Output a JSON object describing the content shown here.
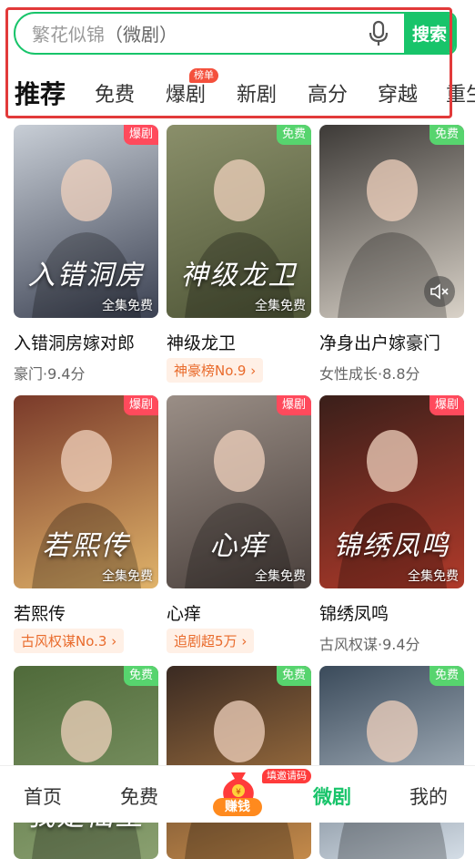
{
  "search": {
    "placeholder_main": "繁花似锦",
    "placeholder_tag": "（微剧）",
    "button": "搜索"
  },
  "tabs": [
    {
      "label": "推荐",
      "active": true
    },
    {
      "label": "免费"
    },
    {
      "label": "爆剧",
      "badge": "榜单"
    },
    {
      "label": "新剧"
    },
    {
      "label": "高分"
    },
    {
      "label": "穿越"
    },
    {
      "label": "重生"
    }
  ],
  "cards": [
    {
      "title": "入错洞房嫁对郎",
      "corner": "爆剧",
      "full": "全集免费",
      "overlay": "入错洞房",
      "sub": "豪门·9.4分",
      "colors": [
        "#c8ced6",
        "#3b4152"
      ]
    },
    {
      "title": "神级龙卫",
      "corner": "免费",
      "full": "全集免费",
      "overlay": "神级龙卫",
      "rank": "神豪榜No.9",
      "colors": [
        "#8a8f6a",
        "#4e5536"
      ]
    },
    {
      "title": "净身出户嫁豪门",
      "corner": "免费",
      "full": "",
      "overlay": "",
      "sub": "女性成长·8.8分",
      "colors": [
        "#3d3a37",
        "#d9d2c8"
      ]
    },
    {
      "title": "若熙传",
      "corner": "爆剧",
      "full": "全集免费",
      "overlay": "若熙传",
      "rank": "古风权谋No.3",
      "colors": [
        "#7a3a2a",
        "#e0b36a"
      ]
    },
    {
      "title": "心痒",
      "corner": "爆剧",
      "full": "全集免费",
      "overlay": "心痒",
      "rank": "追剧超5万",
      "colors": [
        "#9a8e86",
        "#4a403c"
      ]
    },
    {
      "title": "锦绣凤鸣",
      "corner": "爆剧",
      "full": "全集免费",
      "overlay": "锦绣凤鸣",
      "sub": "古风权谋·9.4分",
      "colors": [
        "#3a1f1a",
        "#b03a2a"
      ]
    },
    {
      "title": "",
      "corner": "免费",
      "full": "",
      "overlay": "我是仙王",
      "sub": "",
      "colors": [
        "#4f6a3a",
        "#8aa070"
      ]
    },
    {
      "title": "",
      "corner": "免费",
      "full": "",
      "overlay": "",
      "sub": "",
      "colors": [
        "#3a2a22",
        "#c48a4a"
      ]
    },
    {
      "title": "",
      "corner": "免费",
      "full": "",
      "overlay": "",
      "sub": "",
      "colors": [
        "#3a4a5a",
        "#d4dde6"
      ]
    }
  ],
  "nav": {
    "home": "首页",
    "free": "免费",
    "earn": "赚钱",
    "invite": "填邀请码",
    "micro": "微剧",
    "mine": "我的"
  },
  "theme": {
    "accent": "#18c46a",
    "hot": "#ff4a5c",
    "free": "#57d46e",
    "frame": "#e23a3a"
  }
}
